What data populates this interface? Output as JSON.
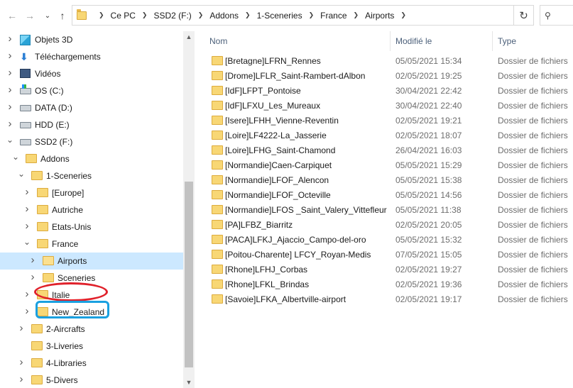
{
  "addressbar": {
    "crumbs": [
      "Ce PC",
      "SSD2 (F:)",
      "Addons",
      "1-Sceneries",
      "France",
      "Airports"
    ],
    "back_icon": "arrow-left-icon",
    "forward_icon": "arrow-right-icon",
    "up_icon": "arrow-up-icon",
    "refresh_icon": "refresh-icon",
    "search_icon": "search-icon"
  },
  "navpane": {
    "items": [
      {
        "label": "Objets 3D",
        "icon": "cube-3d-icon",
        "expand": "collapsed",
        "level": 0
      },
      {
        "label": "Téléchargements",
        "icon": "download-icon",
        "expand": "collapsed",
        "level": 0
      },
      {
        "label": "Vidéos",
        "icon": "video-icon",
        "expand": "collapsed",
        "level": 0
      },
      {
        "label": "OS (C:)",
        "icon": "drive-windows-icon",
        "expand": "collapsed",
        "level": 0
      },
      {
        "label": "DATA (D:)",
        "icon": "drive-icon",
        "expand": "collapsed",
        "level": 0
      },
      {
        "label": "HDD (E:)",
        "icon": "drive-icon",
        "expand": "collapsed",
        "level": 0
      },
      {
        "label": "SSD2 (F:)",
        "icon": "drive-icon",
        "expand": "expanded",
        "level": 0
      },
      {
        "label": "Addons",
        "icon": "folder-icon",
        "expand": "expanded",
        "level": 1
      },
      {
        "label": "1-Sceneries",
        "icon": "folder-icon",
        "expand": "expanded",
        "level": 2
      },
      {
        "label": "[Europe]",
        "icon": "folder-icon",
        "expand": "collapsed",
        "level": 3
      },
      {
        "label": "Autriche",
        "icon": "folder-icon",
        "expand": "collapsed",
        "level": 3
      },
      {
        "label": "Etats-Unis",
        "icon": "folder-icon",
        "expand": "collapsed",
        "level": 3
      },
      {
        "label": "France",
        "icon": "folder-icon",
        "expand": "expanded",
        "level": 3
      },
      {
        "label": "Airports",
        "icon": "folder-open-icon",
        "expand": "collapsed",
        "level": 4,
        "selected": true
      },
      {
        "label": "Sceneries",
        "icon": "folder-icon",
        "expand": "collapsed",
        "level": 4
      },
      {
        "label": "Italie",
        "icon": "folder-icon",
        "expand": "collapsed",
        "level": 3
      },
      {
        "label": "New_Zealand",
        "icon": "folder-icon",
        "expand": "collapsed",
        "level": 3
      },
      {
        "label": "2-Aircrafts",
        "icon": "folder-icon",
        "expand": "collapsed",
        "level": 2
      },
      {
        "label": "3-Liveries",
        "icon": "folder-icon",
        "expand": "none",
        "level": 2
      },
      {
        "label": "4-Libraries",
        "icon": "folder-icon",
        "expand": "collapsed",
        "level": 2
      },
      {
        "label": "5-Divers",
        "icon": "folder-icon",
        "expand": "collapsed",
        "level": 2
      }
    ]
  },
  "filelist": {
    "columns": {
      "name": "Nom",
      "modified": "Modifié le",
      "type": "Type"
    },
    "rows": [
      {
        "name": "[Bretagne]LFRN_Rennes",
        "modified": "05/05/2021 15:34",
        "type": "Dossier de fichiers"
      },
      {
        "name": "[Drome]LFLR_Saint-Rambert-dAlbon",
        "modified": "02/05/2021 19:25",
        "type": "Dossier de fichiers"
      },
      {
        "name": "[IdF]LFPT_Pontoise",
        "modified": "30/04/2021 22:42",
        "type": "Dossier de fichiers"
      },
      {
        "name": "[IdF]LFXU_Les_Mureaux",
        "modified": "30/04/2021 22:40",
        "type": "Dossier de fichiers"
      },
      {
        "name": "[Isere]LFHH_Vienne-Reventin",
        "modified": "02/05/2021 19:21",
        "type": "Dossier de fichiers"
      },
      {
        "name": "[Loire]LF4222-La_Jasserie",
        "modified": "02/05/2021 18:07",
        "type": "Dossier de fichiers"
      },
      {
        "name": "[Loire]LFHG_Saint-Chamond",
        "modified": "26/04/2021 16:03",
        "type": "Dossier de fichiers"
      },
      {
        "name": "[Normandie]Caen-Carpiquet",
        "modified": "05/05/2021 15:29",
        "type": "Dossier de fichiers"
      },
      {
        "name": "[Normandie]LFOF_Alencon",
        "modified": "05/05/2021 15:38",
        "type": "Dossier de fichiers"
      },
      {
        "name": "[Normandie]LFOF_Octeville",
        "modified": "05/05/2021 14:56",
        "type": "Dossier de fichiers"
      },
      {
        "name": "[Normandie]LFOS _Saint_Valery_Vittefleur",
        "modified": "05/05/2021 11:38",
        "type": "Dossier de fichiers"
      },
      {
        "name": "[PA]LFBZ_Biarritz",
        "modified": "02/05/2021 20:05",
        "type": "Dossier de fichiers"
      },
      {
        "name": "[PACA]LFKJ_Ajaccio_Campo-del-oro",
        "modified": "05/05/2021 15:32",
        "type": "Dossier de fichiers"
      },
      {
        "name": "[Poitou-Charente] LFCY_Royan-Medis",
        "modified": "07/05/2021 15:05",
        "type": "Dossier de fichiers"
      },
      {
        "name": "[Rhone]LFHJ_Corbas",
        "modified": "02/05/2021 19:27",
        "type": "Dossier de fichiers"
      },
      {
        "name": "[Rhone]LFKL_Brindas",
        "modified": "02/05/2021 19:36",
        "type": "Dossier de fichiers"
      },
      {
        "name": "[Savoie]LFKA_Albertville-airport",
        "modified": "02/05/2021 19:17",
        "type": "Dossier de fichiers"
      }
    ]
  },
  "colors": {
    "selection": "#cce8ff",
    "folder": "#f8d775",
    "annotation_red": "#e0212b",
    "annotation_blue": "#1aa0e0"
  }
}
